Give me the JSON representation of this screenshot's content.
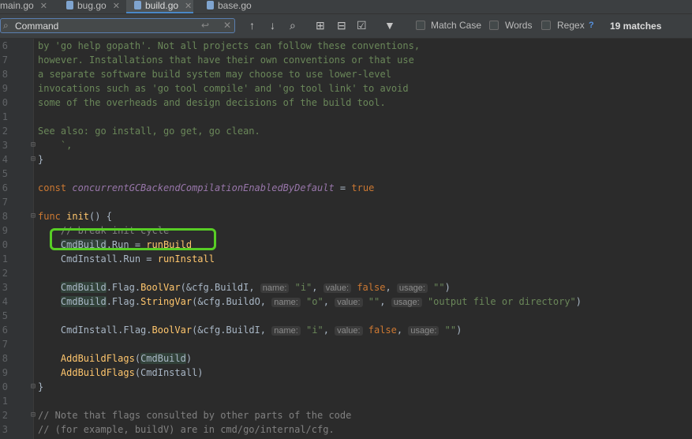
{
  "tabs": [
    {
      "label": "main.go",
      "active": false
    },
    {
      "label": "bug.go",
      "active": false
    },
    {
      "label": "build.go",
      "active": true
    },
    {
      "label": "base.go",
      "active": false
    }
  ],
  "icons": {
    "search": "search-icon",
    "newline": "newline-icon",
    "clear": "clear-icon",
    "close_tab": "close-icon",
    "prev": "arrow-up-icon",
    "next": "arrow-down-icon",
    "find_usages": "find-in-path-icon",
    "add_selection": "add-selection-icon",
    "remove_selection": "remove-selection-icon",
    "select_all": "select-all-occurrences-icon",
    "filter": "filter-icon",
    "help": "help-icon"
  },
  "find": {
    "query": "Command",
    "match_case": "Match Case",
    "words": "Words",
    "regex": "Regex",
    "help": "?",
    "matches": "19 matches",
    "accent": "#58cd25"
  },
  "lines": [
    {
      "n": "6",
      "fold": "",
      "t": [
        {
          "c": "str",
          "v": "by 'go help gopath'. Not all projects can follow these conventions,"
        }
      ]
    },
    {
      "n": "7",
      "fold": "",
      "t": [
        {
          "c": "str",
          "v": "however. Installations that have their own conventions or that use"
        }
      ]
    },
    {
      "n": "8",
      "fold": "",
      "t": [
        {
          "c": "str",
          "v": "a separate software build system may choose to use lower-level"
        }
      ]
    },
    {
      "n": "9",
      "fold": "",
      "t": [
        {
          "c": "str",
          "v": "invocations such as 'go tool compile' and 'go tool link' to avoid"
        }
      ]
    },
    {
      "n": "0",
      "fold": "",
      "t": [
        {
          "c": "str",
          "v": "some of the overheads and design decisions of the build tool."
        }
      ]
    },
    {
      "n": "1",
      "fold": "",
      "t": []
    },
    {
      "n": "2",
      "fold": "",
      "t": [
        {
          "c": "str",
          "v": "See also: go install, go get, go clean."
        }
      ]
    },
    {
      "n": "3",
      "fold": "⊟",
      "t": [
        {
          "c": "str",
          "v": "    `,"
        }
      ]
    },
    {
      "n": "4",
      "fold": "⊟",
      "t": [
        {
          "c": "ident",
          "v": "}"
        }
      ]
    },
    {
      "n": "5",
      "fold": "",
      "t": []
    },
    {
      "n": "6",
      "fold": "",
      "t": [
        {
          "c": "kw",
          "v": "const "
        },
        {
          "c": "con",
          "v": "concurrentGCBackendCompilationEnabledByDefault"
        },
        {
          "c": "ident",
          "v": " = "
        },
        {
          "c": "kw",
          "v": "true"
        }
      ]
    },
    {
      "n": "7",
      "fold": "",
      "t": []
    },
    {
      "n": "8",
      "fold": "⊟",
      "t": [
        {
          "c": "kw",
          "v": "func "
        },
        {
          "c": "fn",
          "v": "init"
        },
        {
          "c": "ident",
          "v": "() {"
        }
      ]
    },
    {
      "n": "9",
      "fold": "",
      "t": [
        {
          "c": "cmt",
          "v": "    // break init cycle"
        }
      ]
    },
    {
      "n": "0",
      "fold": "",
      "t": [
        {
          "c": "ident",
          "v": "    "
        },
        {
          "c": "sel",
          "v": "CmdBuild"
        },
        {
          "c": "ident",
          "v": ".Run = "
        },
        {
          "c": "fn",
          "v": "runBuild"
        }
      ]
    },
    {
      "n": "1",
      "fold": "",
      "t": [
        {
          "c": "ident",
          "v": "    CmdInstall.Run = "
        },
        {
          "c": "fn",
          "v": "runInstall"
        }
      ]
    },
    {
      "n": "2",
      "fold": "",
      "t": []
    },
    {
      "n": "3",
      "fold": "",
      "t": [
        {
          "c": "ident",
          "v": "    "
        },
        {
          "c": "sel",
          "v": "CmdBuild"
        },
        {
          "c": "ident",
          "v": ".Flag."
        },
        {
          "c": "fn",
          "v": "BoolVar"
        },
        {
          "c": "ident",
          "v": "(&cfg.BuildI, "
        },
        {
          "c": "hint",
          "v": "name:"
        },
        {
          "c": "str",
          "v": " \"i\""
        },
        {
          "c": "ident",
          "v": ", "
        },
        {
          "c": "hint",
          "v": "value:"
        },
        {
          "c": "kw",
          "v": " false"
        },
        {
          "c": "ident",
          "v": ", "
        },
        {
          "c": "hint",
          "v": "usage:"
        },
        {
          "c": "str",
          "v": " \"\""
        },
        {
          "c": "ident",
          "v": ")"
        }
      ]
    },
    {
      "n": "4",
      "fold": "",
      "t": [
        {
          "c": "ident",
          "v": "    "
        },
        {
          "c": "sel",
          "v": "CmdBuild"
        },
        {
          "c": "ident",
          "v": ".Flag."
        },
        {
          "c": "fn",
          "v": "StringVar"
        },
        {
          "c": "ident",
          "v": "(&cfg.BuildO, "
        },
        {
          "c": "hint",
          "v": "name:"
        },
        {
          "c": "str",
          "v": " \"o\""
        },
        {
          "c": "ident",
          "v": ", "
        },
        {
          "c": "hint",
          "v": "value:"
        },
        {
          "c": "str",
          "v": " \"\""
        },
        {
          "c": "ident",
          "v": ", "
        },
        {
          "c": "hint",
          "v": "usage:"
        },
        {
          "c": "str",
          "v": " \"output file or directory\""
        },
        {
          "c": "ident",
          "v": ")"
        }
      ]
    },
    {
      "n": "5",
      "fold": "",
      "t": []
    },
    {
      "n": "6",
      "fold": "",
      "t": [
        {
          "c": "ident",
          "v": "    CmdInstall.Flag."
        },
        {
          "c": "fn",
          "v": "BoolVar"
        },
        {
          "c": "ident",
          "v": "(&cfg.BuildI, "
        },
        {
          "c": "hint",
          "v": "name:"
        },
        {
          "c": "str",
          "v": " \"i\""
        },
        {
          "c": "ident",
          "v": ", "
        },
        {
          "c": "hint",
          "v": "value:"
        },
        {
          "c": "kw",
          "v": " false"
        },
        {
          "c": "ident",
          "v": ", "
        },
        {
          "c": "hint",
          "v": "usage:"
        },
        {
          "c": "str",
          "v": " \"\""
        },
        {
          "c": "ident",
          "v": ")"
        }
      ]
    },
    {
      "n": "7",
      "fold": "",
      "t": []
    },
    {
      "n": "8",
      "fold": "",
      "t": [
        {
          "c": "ident",
          "v": "    "
        },
        {
          "c": "fn",
          "v": "AddBuildFlags"
        },
        {
          "c": "ident",
          "v": "("
        },
        {
          "c": "sel",
          "v": "CmdBuild"
        },
        {
          "c": "ident",
          "v": ")"
        }
      ]
    },
    {
      "n": "9",
      "fold": "",
      "t": [
        {
          "c": "ident",
          "v": "    "
        },
        {
          "c": "fn",
          "v": "AddBuildFlags"
        },
        {
          "c": "ident",
          "v": "(CmdInstall)"
        }
      ]
    },
    {
      "n": "0",
      "fold": "⊟",
      "t": [
        {
          "c": "ident",
          "v": "}"
        }
      ]
    },
    {
      "n": "1",
      "fold": "",
      "t": []
    },
    {
      "n": "2",
      "fold": "⊟",
      "t": [
        {
          "c": "cmt",
          "v": "// Note that flags consulted by other parts of the code"
        }
      ]
    },
    {
      "n": "3",
      "fold": "",
      "t": [
        {
          "c": "cmt",
          "v": "// (for example, buildV) are in cmd/go/internal/cfg."
        }
      ]
    }
  ]
}
